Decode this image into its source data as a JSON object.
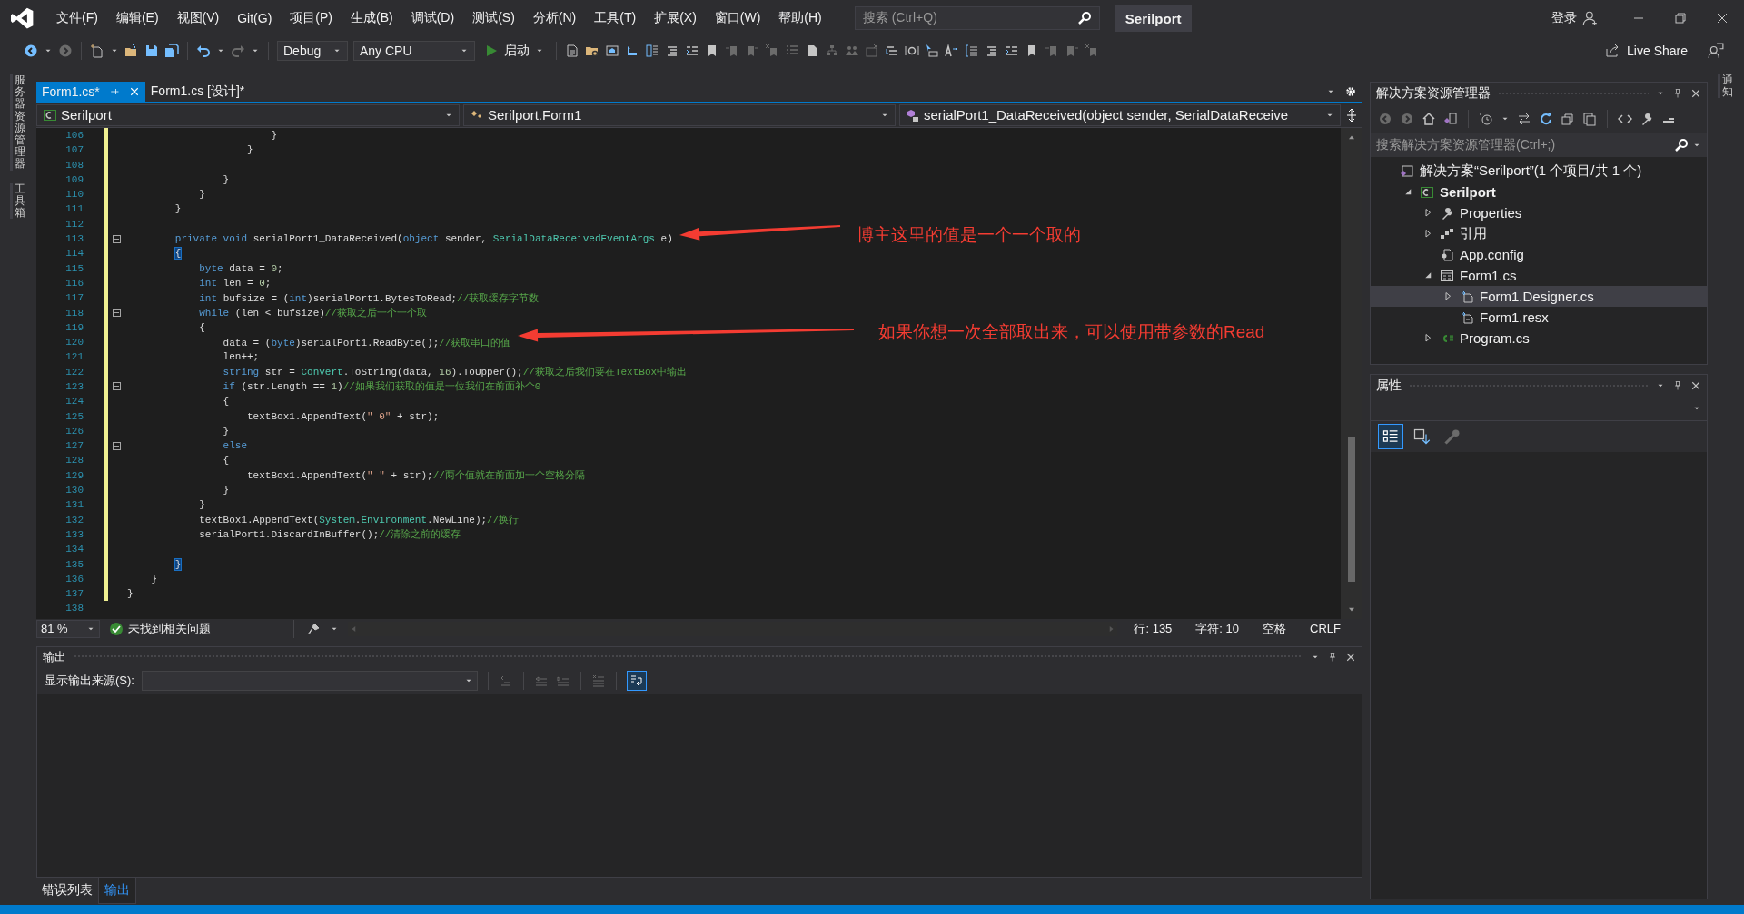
{
  "menu_bar": {
    "items": [
      "文件(F)",
      "编辑(E)",
      "视图(V)",
      "Git(G)",
      "项目(P)",
      "生成(B)",
      "调试(D)",
      "测试(S)",
      "分析(N)",
      "工具(T)",
      "扩展(X)",
      "窗口(W)",
      "帮助(H)"
    ],
    "search": {
      "placeholder": "搜索 (Ctrl+Q)"
    },
    "solution_name": "Serilport",
    "login": "登录"
  },
  "toolbar": {
    "configuration": "Debug",
    "platform": "Any CPU",
    "start": "启动",
    "live_share": "Live Share"
  },
  "left_strip": [
    "服务器资源管理器",
    "工具箱"
  ],
  "right_strip": [
    "通知"
  ],
  "doc_tabs": [
    {
      "label": "Form1.cs*",
      "selected": true
    },
    {
      "label": "Form1.cs [设计]*",
      "selected": false
    }
  ],
  "nav_bar": {
    "project": "Serilport",
    "class": "Serilport.Form1",
    "member": "serialPort1_DataReceived(object sender, SerialDataReceive"
  },
  "code_lines": [
    {
      "number": "106",
      "changed": true,
      "fold_marker": false,
      "tokens": [
        {
          "kind": "plain",
          "text": "                        }"
        }
      ]
    },
    {
      "number": "107",
      "changed": true,
      "fold_marker": false,
      "tokens": [
        {
          "kind": "plain",
          "text": "                    }"
        }
      ]
    },
    {
      "number": "108",
      "changed": true,
      "fold_marker": false
    },
    {
      "number": "109",
      "changed": true,
      "fold_marker": false,
      "tokens": [
        {
          "kind": "plain",
          "text": "                }"
        }
      ]
    },
    {
      "number": "110",
      "changed": true,
      "fold_marker": false,
      "tokens": [
        {
          "kind": "plain",
          "text": "            }"
        }
      ]
    },
    {
      "number": "111",
      "changed": true,
      "fold_marker": false,
      "tokens": [
        {
          "kind": "plain",
          "text": "        }"
        }
      ]
    },
    {
      "number": "112",
      "changed": true,
      "fold_marker": false
    },
    {
      "number": "113",
      "changed": true,
      "fold_marker": true,
      "tokens": [
        {
          "kind": "kw",
          "text": "        private void"
        },
        {
          "kind": "plain",
          "text": " serialPort1_DataReceived("
        },
        {
          "kind": "kw",
          "text": "object"
        },
        {
          "kind": "plain",
          "text": " sender, "
        },
        {
          "kind": "type",
          "text": "SerialDataReceivedEventArgs"
        },
        {
          "kind": "plain",
          "text": " e)"
        }
      ]
    },
    {
      "number": "114",
      "changed": true,
      "fold_marker": false,
      "tokens": [
        {
          "kind": "brace",
          "text": "        {"
        }
      ]
    },
    {
      "number": "115",
      "changed": true,
      "fold_marker": false,
      "tokens": [
        {
          "kind": "kw",
          "text": "            byte"
        },
        {
          "kind": "plain",
          "text": " data = "
        },
        {
          "kind": "num",
          "text": "0"
        },
        {
          "kind": "plain",
          "text": ";"
        }
      ]
    },
    {
      "number": "116",
      "changed": true,
      "fold_marker": false,
      "tokens": [
        {
          "kind": "kw",
          "text": "            int"
        },
        {
          "kind": "plain",
          "text": " len = "
        },
        {
          "kind": "num",
          "text": "0"
        },
        {
          "kind": "plain",
          "text": ";"
        }
      ]
    },
    {
      "number": "117",
      "changed": true,
      "fold_marker": false,
      "tokens": [
        {
          "kind": "kw",
          "text": "            int"
        },
        {
          "kind": "plain",
          "text": " bufsize = ("
        },
        {
          "kind": "kw",
          "text": "int"
        },
        {
          "kind": "plain",
          "text": ")serialPort1.BytesToRead;"
        },
        {
          "kind": "comment",
          "text": "//获取缓存字节数"
        }
      ]
    },
    {
      "number": "118",
      "changed": true,
      "fold_marker": true,
      "tokens": [
        {
          "kind": "kw",
          "text": "            while"
        },
        {
          "kind": "plain",
          "text": " (len < bufsize)"
        },
        {
          "kind": "comment",
          "text": "//获取之后一个一个取"
        }
      ]
    },
    {
      "number": "119",
      "changed": true,
      "fold_marker": false,
      "tokens": [
        {
          "kind": "plain",
          "text": "            {"
        }
      ]
    },
    {
      "number": "120",
      "changed": true,
      "fold_marker": false,
      "tokens": [
        {
          "kind": "plain",
          "text": "                data = ("
        },
        {
          "kind": "kw",
          "text": "byte"
        },
        {
          "kind": "plain",
          "text": ")serialPort1.ReadByte();"
        },
        {
          "kind": "comment",
          "text": "//获取串口的值"
        }
      ]
    },
    {
      "number": "121",
      "changed": true,
      "fold_marker": false,
      "tokens": [
        {
          "kind": "plain",
          "text": "                len++;"
        }
      ]
    },
    {
      "number": "122",
      "changed": true,
      "fold_marker": false,
      "tokens": [
        {
          "kind": "kw",
          "text": "                string"
        },
        {
          "kind": "plain",
          "text": " str = "
        },
        {
          "kind": "type",
          "text": "Convert"
        },
        {
          "kind": "plain",
          "text": ".ToString(data, "
        },
        {
          "kind": "num",
          "text": "16"
        },
        {
          "kind": "plain",
          "text": ").ToUpper();"
        },
        {
          "kind": "comment",
          "text": "//获取之后我们要在TextBox中输出"
        }
      ]
    },
    {
      "number": "123",
      "changed": true,
      "fold_marker": true,
      "tokens": [
        {
          "kind": "kw",
          "text": "                if"
        },
        {
          "kind": "plain",
          "text": " (str.Length == "
        },
        {
          "kind": "num",
          "text": "1"
        },
        {
          "kind": "plain",
          "text": ")"
        },
        {
          "kind": "comment",
          "text": "//如果我们获取的值是一位我们在前面补个0"
        }
      ]
    },
    {
      "number": "124",
      "changed": true,
      "fold_marker": false,
      "tokens": [
        {
          "kind": "plain",
          "text": "                {"
        }
      ]
    },
    {
      "number": "125",
      "changed": true,
      "fold_marker": false,
      "tokens": [
        {
          "kind": "plain",
          "text": "                    textBox1.AppendText("
        },
        {
          "kind": "str",
          "text": "\" 0\""
        },
        {
          "kind": "plain",
          "text": " + str);"
        }
      ]
    },
    {
      "number": "126",
      "changed": true,
      "fold_marker": false,
      "tokens": [
        {
          "kind": "plain",
          "text": "                }"
        }
      ]
    },
    {
      "number": "127",
      "changed": true,
      "fold_marker": true,
      "tokens": [
        {
          "kind": "kw",
          "text": "                else"
        }
      ]
    },
    {
      "number": "128",
      "changed": true,
      "fold_marker": false,
      "tokens": [
        {
          "kind": "plain",
          "text": "                {"
        }
      ]
    },
    {
      "number": "129",
      "changed": true,
      "fold_marker": false,
      "tokens": [
        {
          "kind": "plain",
          "text": "                    textBox1.AppendText("
        },
        {
          "kind": "str",
          "text": "\" \""
        },
        {
          "kind": "plain",
          "text": " + str);"
        },
        {
          "kind": "comment",
          "text": "//两个值就在前面加一个空格分隔"
        }
      ]
    },
    {
      "number": "130",
      "changed": true,
      "fold_marker": false,
      "tokens": [
        {
          "kind": "plain",
          "text": "                }"
        }
      ]
    },
    {
      "number": "131",
      "changed": true,
      "fold_marker": false,
      "tokens": [
        {
          "kind": "plain",
          "text": "            }"
        }
      ]
    },
    {
      "number": "132",
      "changed": true,
      "fold_marker": false,
      "tokens": [
        {
          "kind": "plain",
          "text": "            textBox1.AppendText("
        },
        {
          "kind": "type",
          "text": "System"
        },
        {
          "kind": "plain",
          "text": "."
        },
        {
          "kind": "type",
          "text": "Environment"
        },
        {
          "kind": "plain",
          "text": ".NewLine);"
        },
        {
          "kind": "comment",
          "text": "//换行"
        }
      ]
    },
    {
      "number": "133",
      "changed": true,
      "fold_marker": false,
      "tokens": [
        {
          "kind": "plain",
          "text": "            serialPort1.DiscardInBuffer();"
        },
        {
          "kind": "comment",
          "text": "//清除之前的缓存"
        }
      ]
    },
    {
      "number": "134",
      "changed": true,
      "fold_marker": false
    },
    {
      "number": "135",
      "changed": true,
      "fold_marker": false,
      "tokens": [
        {
          "kind": "brace",
          "text": "        }"
        }
      ]
    },
    {
      "number": "136",
      "changed": true,
      "fold_marker": false,
      "tokens": [
        {
          "kind": "plain",
          "text": "    }"
        }
      ]
    },
    {
      "number": "137",
      "changed": true,
      "fold_marker": false,
      "tokens": [
        {
          "kind": "plain",
          "text": "}"
        }
      ]
    },
    {
      "number": "138",
      "changed": false,
      "fold_marker": false
    }
  ],
  "annotations": [
    {
      "text": "博主这里的值是一个一个取的"
    },
    {
      "text": "如果你想一次全部取出来，可以使用带参数的Read"
    }
  ],
  "editor_status": {
    "zoom": "81 %",
    "issues": "未找到相关问题",
    "line": "行: 135",
    "char": "字符: 10",
    "whitespace": "空格",
    "line_ending": "CRLF"
  },
  "output": {
    "title": "输出",
    "source_label": "显示输出来源(S):",
    "word_wrap": true
  },
  "bottom_tabs": [
    {
      "label": "错误列表",
      "selected": false
    },
    {
      "label": "输出",
      "selected": true
    }
  ],
  "solution_explorer": {
    "title": "解决方案资源管理器",
    "search": {
      "placeholder": "搜索解决方案资源管理器(Ctrl+;)"
    },
    "tree": [
      {
        "label": "解决方案“Serilport”(1 个项目/共 1 个)",
        "kind": "solution",
        "selected": false,
        "children": [
          {
            "label": "Serilport",
            "kind": "project",
            "selected": false,
            "expanded": true,
            "children": [
              {
                "label": "Properties",
                "kind": "properties",
                "selected": false,
                "expanded": false
              },
              {
                "label": "引用",
                "kind": "references",
                "selected": false,
                "expanded": false
              },
              {
                "label": "App.config",
                "kind": "config",
                "selected": false
              },
              {
                "label": "Form1.cs",
                "kind": "form",
                "selected": false,
                "expanded": true,
                "children": [
                  {
                    "label": "Form1.Designer.cs",
                    "kind": "designer",
                    "selected": true,
                    "expanded": false
                  },
                  {
                    "label": "Form1.resx",
                    "kind": "resx",
                    "selected": false
                  }
                ]
              },
              {
                "label": "Program.cs",
                "kind": "csharp",
                "selected": false,
                "expanded": false
              }
            ]
          }
        ]
      }
    ]
  },
  "properties": {
    "title": "属性",
    "view_buttons": [
      {
        "kind": "categorized",
        "selected": true
      },
      {
        "kind": "alphabetical",
        "selected": false
      },
      {
        "kind": "pages",
        "selected": false
      }
    ]
  }
}
